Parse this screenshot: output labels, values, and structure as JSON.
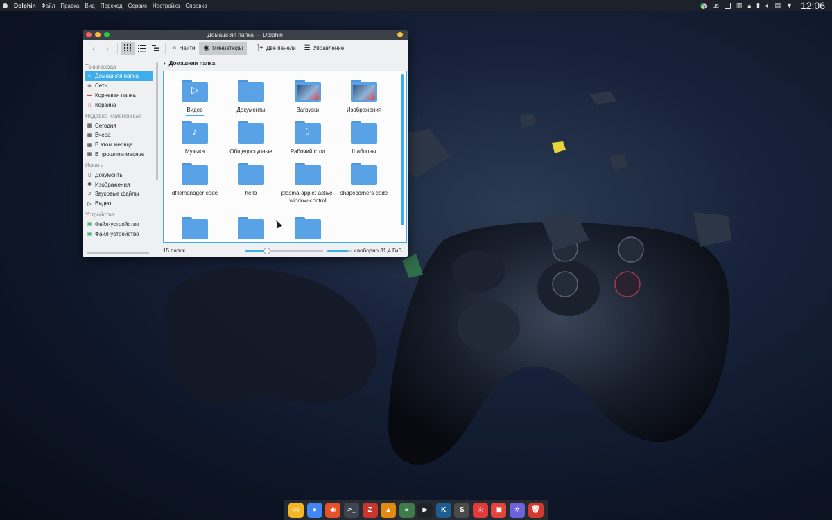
{
  "top_panel": {
    "app_name": "Dolphin",
    "menu": [
      "Файл",
      "Правка",
      "Вид",
      "Переход",
      "Сервис",
      "Настройка",
      "Справка"
    ],
    "keyboard_layout": "us",
    "clock": "12:06"
  },
  "window": {
    "title": "Домашняя папка — Dolphin",
    "toolbar": {
      "find": "Найти",
      "preview": "Миниатюры",
      "split": "Две панели",
      "control": "Управление"
    },
    "sidebar": {
      "sections": [
        {
          "title": "Точки входа",
          "items": [
            {
              "label": "Домашняя папка",
              "icon": "home-icon",
              "active": true
            },
            {
              "label": "Сеть",
              "icon": "network-icon"
            },
            {
              "label": "Корневая папка",
              "icon": "folder-red-icon"
            },
            {
              "label": "Корзина",
              "icon": "trash-icon"
            }
          ]
        },
        {
          "title": "Недавно изменённые",
          "items": [
            {
              "label": "Сегодня",
              "icon": "calendar-icon"
            },
            {
              "label": "Вчера",
              "icon": "calendar-icon"
            },
            {
              "label": "В этом месяце",
              "icon": "calendar-icon"
            },
            {
              "label": "В прошлом месяце",
              "icon": "calendar-icon"
            }
          ]
        },
        {
          "title": "Искать",
          "items": [
            {
              "label": "Документы",
              "icon": "document-icon"
            },
            {
              "label": "Изображения",
              "icon": "image-icon"
            },
            {
              "label": "Звуковые файлы",
              "icon": "audio-icon"
            },
            {
              "label": "Видео",
              "icon": "video-icon"
            }
          ]
        },
        {
          "title": "Устройства",
          "items": [
            {
              "label": "Файл-устройство",
              "icon": "drive-icon"
            },
            {
              "label": "Файл-устройство",
              "icon": "drive-icon"
            }
          ]
        }
      ]
    },
    "breadcrumb": "Домашняя папка",
    "folders": [
      {
        "name": "Видео",
        "glyph": "▷",
        "underline": true
      },
      {
        "name": "Документы",
        "glyph": "▭"
      },
      {
        "name": "Загрузки",
        "thumb": true,
        "thumb_color": "#2c4d7d"
      },
      {
        "name": "Изображения",
        "thumb": true,
        "thumb_color": "#36557a"
      },
      {
        "name": "Музыка",
        "glyph": "♪"
      },
      {
        "name": "Общедоступные",
        "glyph": ""
      },
      {
        "name": "Рабочий стол",
        "glyph": "ℐ"
      },
      {
        "name": "Шаблоны",
        "glyph": ""
      },
      {
        "name": "dfilemanager-code",
        "glyph": ""
      },
      {
        "name": "hello",
        "glyph": ""
      },
      {
        "name": "plasma-applet-active-window-control",
        "glyph": ""
      },
      {
        "name": "shapecorners-code",
        "glyph": ""
      },
      {
        "name": "",
        "glyph": ""
      },
      {
        "name": "",
        "glyph": ""
      },
      {
        "name": "",
        "glyph": ""
      }
    ],
    "status": {
      "count": "15 папок",
      "zoom_level": 0.28,
      "disk_used": 0.85,
      "free_space": "свободно 31,4 ГиБ"
    }
  },
  "dock": {
    "icons": [
      {
        "name": "files-icon",
        "color": "#f5b625",
        "glyph": "▭"
      },
      {
        "name": "chrome-icon",
        "color": "#4285f4",
        "glyph": "●"
      },
      {
        "name": "firefox-icon",
        "color": "#e5522a",
        "glyph": "◉"
      },
      {
        "name": "terminal-icon",
        "color": "#3f4550",
        "glyph": ">_"
      },
      {
        "name": "filezilla-icon",
        "color": "#c9342b",
        "glyph": "Z"
      },
      {
        "name": "vlc-icon",
        "color": "#e58a11",
        "glyph": "▲"
      },
      {
        "name": "notes-icon",
        "color": "#3f7a4a",
        "glyph": "≡"
      },
      {
        "name": "media-player-icon",
        "color": "#1f2228",
        "glyph": "▶"
      },
      {
        "name": "kodi-icon",
        "color": "#1d5d8f",
        "glyph": "K"
      },
      {
        "name": "sublime-icon",
        "color": "#4a4a4a",
        "glyph": "S"
      },
      {
        "name": "recorder-icon",
        "color": "#e33b3b",
        "glyph": "◎"
      },
      {
        "name": "gift-icon",
        "color": "#e2453e",
        "glyph": "▣"
      },
      {
        "name": "settings-icon",
        "color": "#6b63d9",
        "glyph": "✲"
      },
      {
        "name": "trash-icon",
        "color": "#d23a2f",
        "glyph": "🗑"
      }
    ]
  }
}
